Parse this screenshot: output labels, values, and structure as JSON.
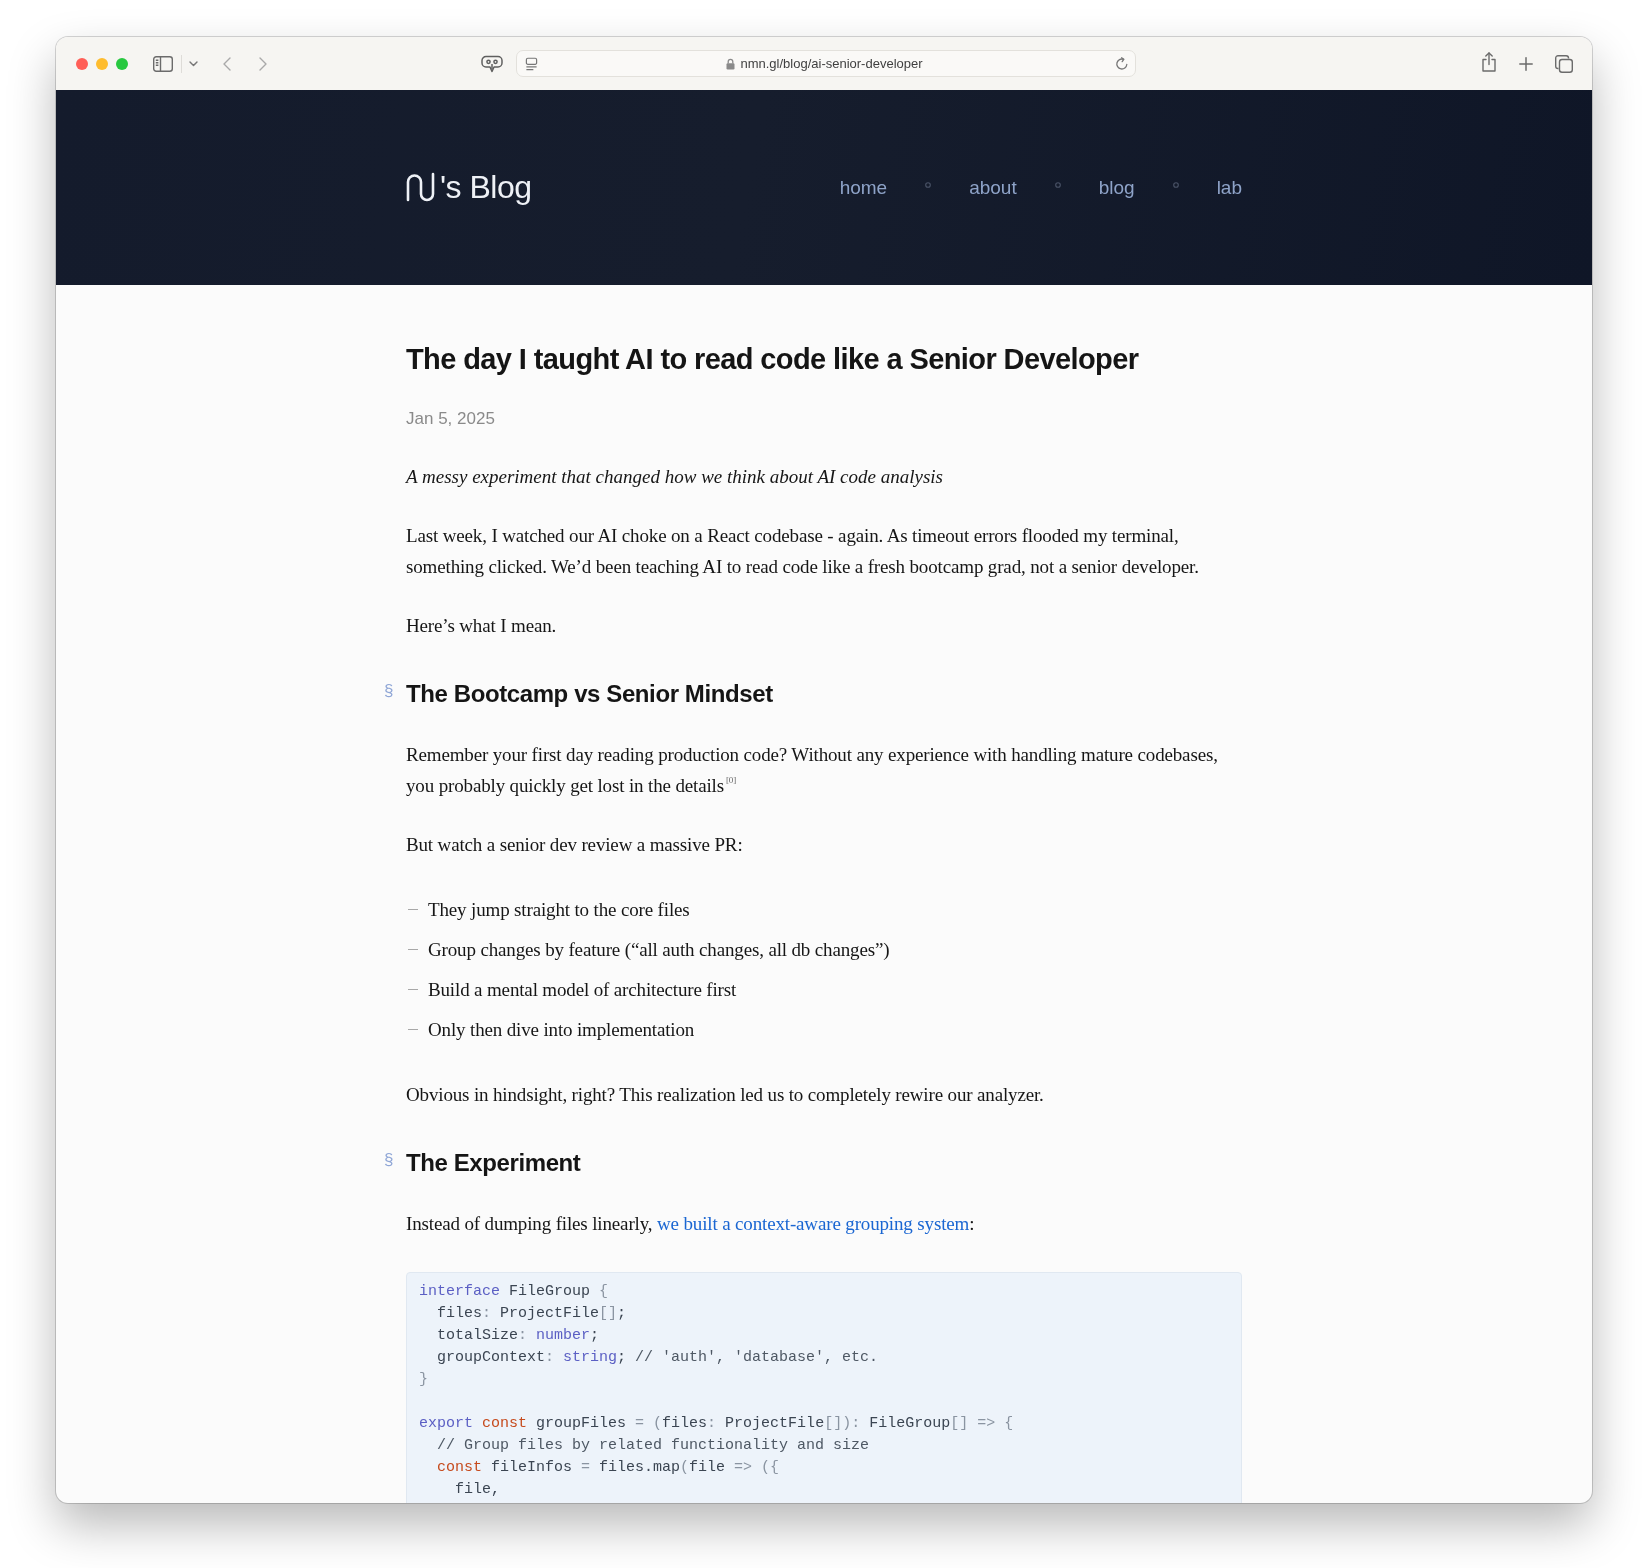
{
  "browser": {
    "url": "nmn.gl/blog/ai-senior-developer"
  },
  "site": {
    "logo_text": "'s Blog",
    "nav": [
      {
        "label": "home"
      },
      {
        "label": "about"
      },
      {
        "label": "blog"
      },
      {
        "label": "lab"
      }
    ]
  },
  "article": {
    "title": "The day I taught AI to read code like a Senior Developer",
    "date": "Jan 5, 2025",
    "blocks": [
      {
        "kind": "lead",
        "text": "A messy experiment that changed how we think about AI code analysis"
      },
      {
        "kind": "paragraph",
        "text": "Last week, I watched our AI choke on a React codebase - again. As timeout errors flooded my terminal, something clicked. We’d been teaching AI to read code like a fresh bootcamp grad, not a senior developer."
      },
      {
        "kind": "paragraph",
        "text": "Here’s what I mean."
      },
      {
        "kind": "heading",
        "anchor": "§",
        "text": "The Bootcamp vs Senior Mindset"
      },
      {
        "kind": "paragraph",
        "text": "Remember your first day reading production code? Without any experience with handling mature codebases, you probably quickly get lost in the details$^{[0]}$"
      },
      {
        "kind": "paragraph",
        "text": "But watch a senior dev review a massive PR:"
      },
      {
        "kind": "list",
        "items": [
          "They jump straight to the core files",
          "Group changes by feature (“all auth changes, all db changes”)",
          "Build a mental model of architecture first",
          "Only then dive into implementation"
        ]
      },
      {
        "kind": "paragraph",
        "text": "Obvious in hindsight, right? This realization led us to completely rewire our analyzer."
      },
      {
        "kind": "heading",
        "anchor": "§",
        "text": "The Experiment"
      },
      {
        "kind": "paragraph",
        "parts": [
          {
            "kind": "text",
            "text": "Instead of dumping files linearly, "
          },
          {
            "kind": "link",
            "text": "we built a context-aware grouping system"
          },
          {
            "kind": "text",
            "text": ":"
          }
        ]
      },
      {
        "kind": "code",
        "lines": [
          {
            "kind": "code",
            "tokens": [
              {
                "kind": "keyword",
                "text": "interface"
              },
              {
                "kind": "text",
                "text": " FileGroup "
              },
              {
                "kind": "punct",
                "text": "{"
              }
            ]
          },
          {
            "kind": "code",
            "tokens": [
              {
                "kind": "text",
                "text": "  files"
              },
              {
                "kind": "punct",
                "text": ":"
              },
              {
                "kind": "text",
                "text": " ProjectFile"
              },
              {
                "kind": "punct",
                "text": "[]"
              },
              {
                "kind": "text",
                "text": ";"
              }
            ]
          },
          {
            "kind": "code",
            "tokens": [
              {
                "kind": "text",
                "text": "  totalSize"
              },
              {
                "kind": "punct",
                "text": ": "
              },
              {
                "kind": "keyword",
                "text": "number"
              },
              {
                "kind": "text",
                "text": ";"
              }
            ]
          },
          {
            "kind": "code",
            "tokens": [
              {
                "kind": "text",
                "text": "  groupContext"
              },
              {
                "kind": "punct",
                "text": ": "
              },
              {
                "kind": "keyword",
                "text": "string"
              },
              {
                "kind": "text",
                "text": "; "
              },
              {
                "kind": "comment",
                "text": "// 'auth', 'database', etc."
              }
            ]
          },
          {
            "kind": "code",
            "tokens": [
              {
                "kind": "punct",
                "text": "}"
              }
            ]
          },
          {
            "kind": "blank"
          },
          {
            "kind": "code",
            "tokens": [
              {
                "kind": "keyword",
                "text": "export "
              },
              {
                "kind": "storage",
                "text": "const"
              },
              {
                "kind": "text",
                "text": " groupFiles "
              },
              {
                "kind": "punct",
                "text": "= ("
              },
              {
                "kind": "text",
                "text": "files"
              },
              {
                "kind": "punct",
                "text": ":"
              },
              {
                "kind": "text",
                "text": " ProjectFile"
              },
              {
                "kind": "punct",
                "text": "[]):"
              },
              {
                "kind": "text",
                "text": " FileGroup"
              },
              {
                "kind": "punct",
                "text": "[] => {"
              }
            ]
          },
          {
            "kind": "code",
            "tokens": [
              {
                "kind": "comment",
                "text": "  // Group files by related functionality and size"
              }
            ]
          },
          {
            "kind": "code",
            "tokens": [
              {
                "kind": "storage",
                "text": "  const"
              },
              {
                "kind": "text",
                "text": " fileInfos "
              },
              {
                "kind": "punct",
                "text": "="
              },
              {
                "kind": "text",
                "text": " files.map"
              },
              {
                "kind": "punct",
                "text": "("
              },
              {
                "kind": "text",
                "text": "file "
              },
              {
                "kind": "punct",
                "text": "=> ({"
              }
            ]
          },
          {
            "kind": "code",
            "tokens": [
              {
                "kind": "text",
                "text": "    file,"
              }
            ]
          }
        ]
      }
    ]
  }
}
